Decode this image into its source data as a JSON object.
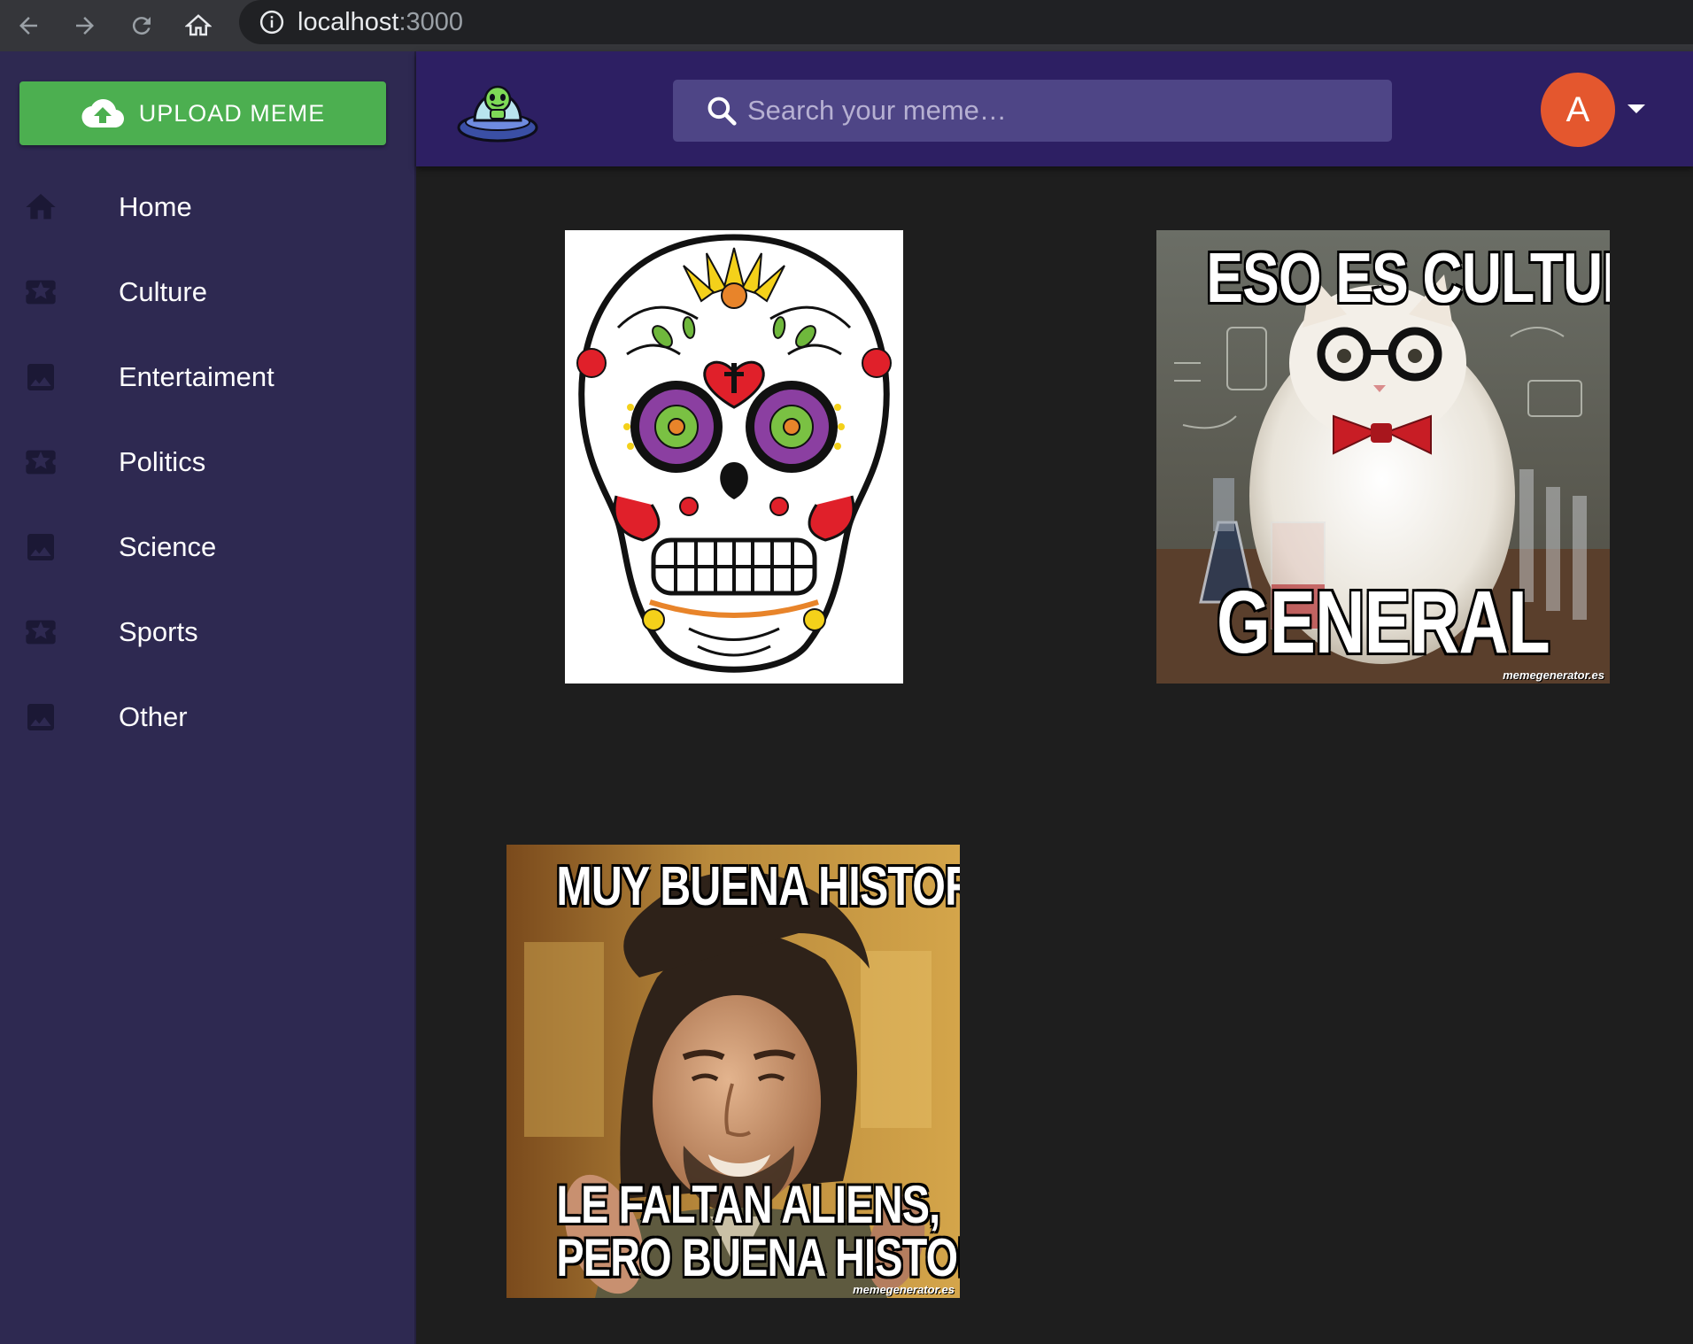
{
  "browser": {
    "url_host": "localhost",
    "url_port": ":3000"
  },
  "sidebar": {
    "upload_label": "UPLOAD MEME",
    "items": [
      {
        "label": "Home",
        "icon": "home-icon"
      },
      {
        "label": "Culture",
        "icon": "ticket-star-icon"
      },
      {
        "label": "Entertaiment",
        "icon": "image-icon"
      },
      {
        "label": "Politics",
        "icon": "ticket-star-icon"
      },
      {
        "label": "Science",
        "icon": "image-icon"
      },
      {
        "label": "Sports",
        "icon": "ticket-star-icon"
      },
      {
        "label": "Other",
        "icon": "image-icon"
      }
    ]
  },
  "header": {
    "search_placeholder": "Search your meme…",
    "avatar_letter": "A"
  },
  "memes": [
    {
      "name": "sugar-skull"
    },
    {
      "name": "science-cat",
      "top_text": "ESO ES CULTURA",
      "bottom_text": "GENERAL",
      "watermark": "memegenerator.es"
    },
    {
      "name": "ancient-aliens",
      "top_text": "MUY BUENA HISTORIA",
      "bottom_text_1": "LE FALTAN ALIENS,",
      "bottom_text_2": "PERO BUENA HISTORIA",
      "watermark": "memegenerator.es"
    }
  ],
  "colors": {
    "sidebar": "#2e2951",
    "appbar": "#2d1f63",
    "upload": "#4caf50",
    "avatar": "#e4572e",
    "content": "#1e1e1e"
  }
}
